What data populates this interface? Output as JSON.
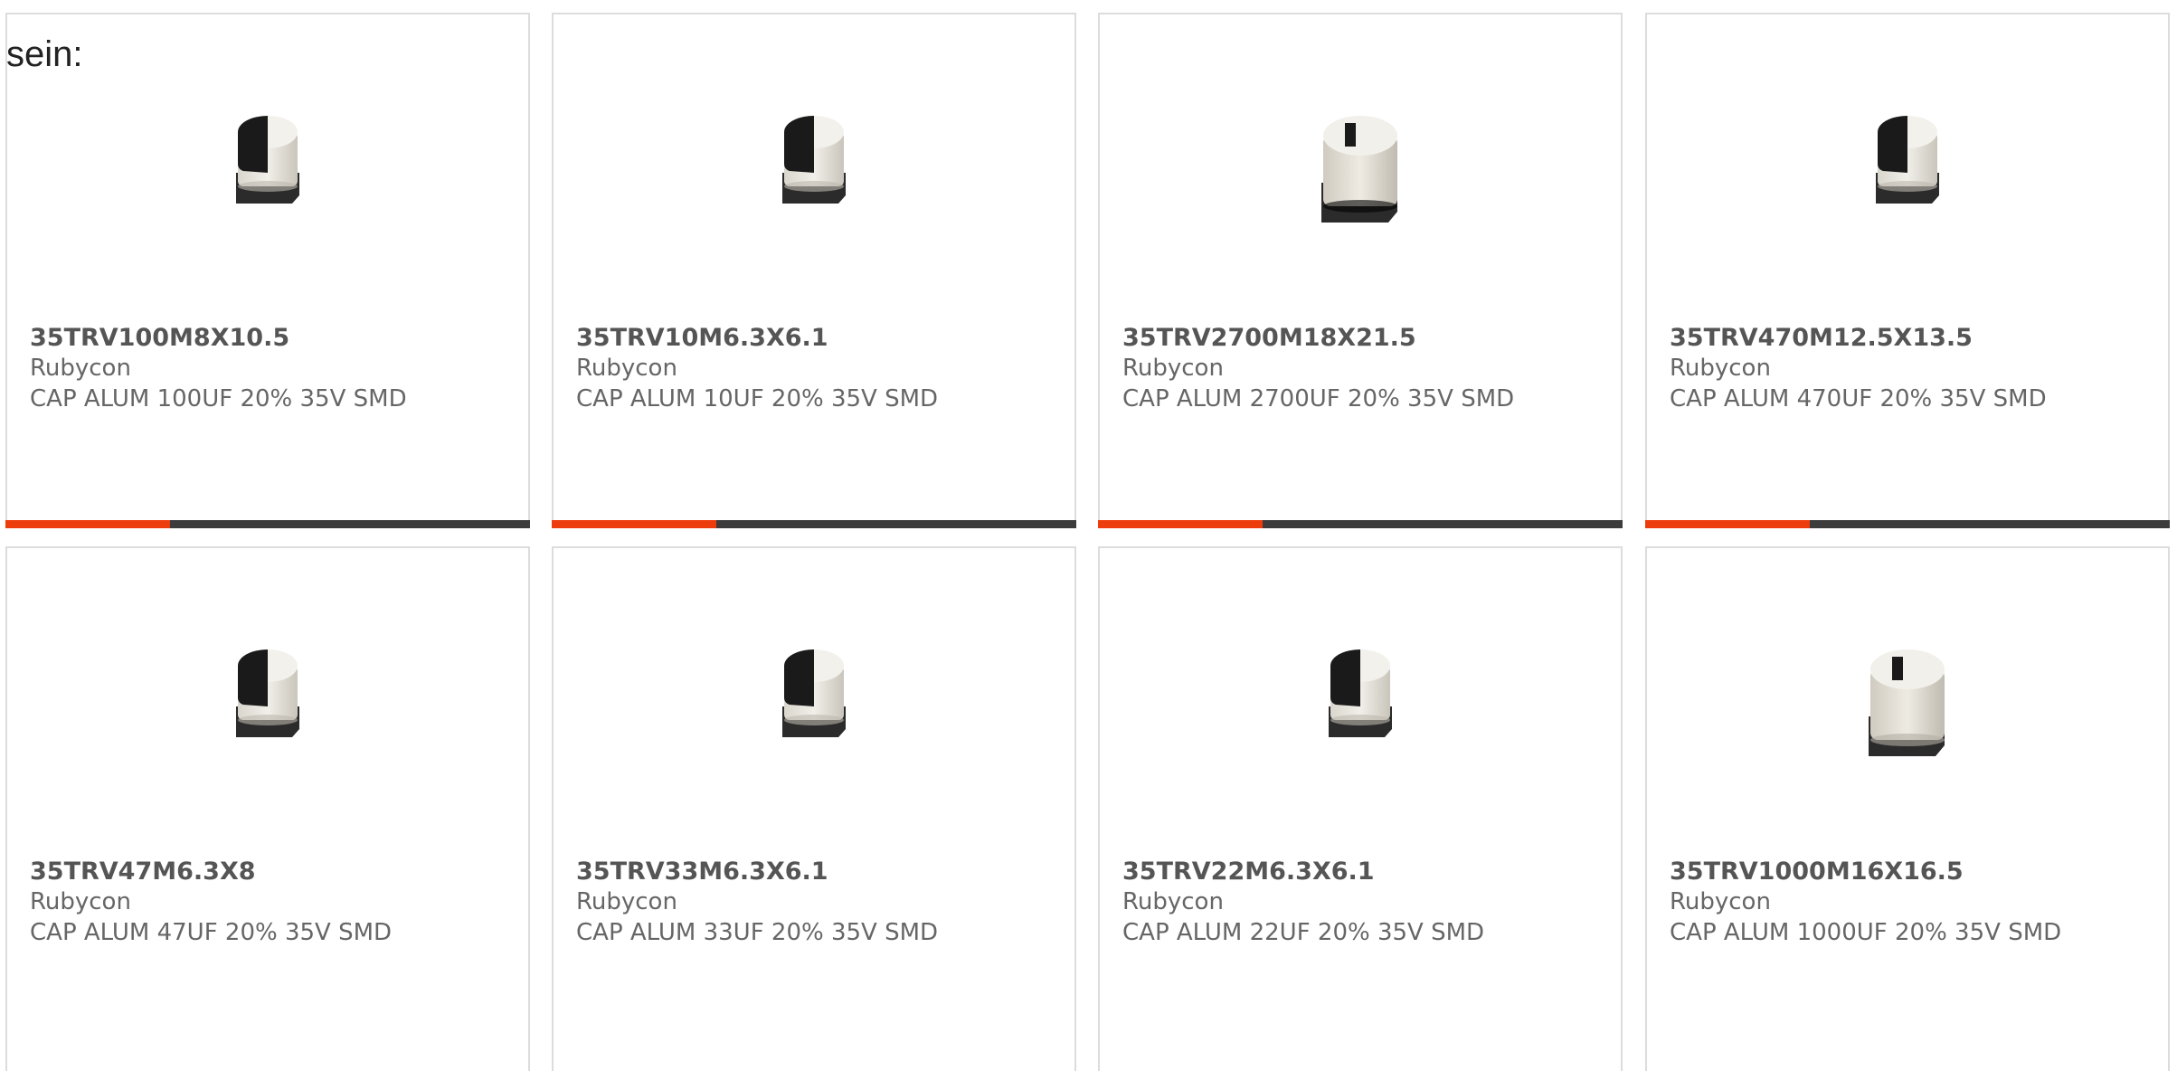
{
  "heading": "sein:",
  "colors": {
    "accent": "#ee3d0d",
    "bar": "#3c3c3c",
    "border": "#dcdcdc",
    "text": "#666666"
  },
  "products": [
    {
      "part_number": "35TRV100M8X10.5",
      "manufacturer": "Rubycon",
      "description": "CAP ALUM 100UF 20% 35V SMD",
      "image": "capacitor-small-icon"
    },
    {
      "part_number": "35TRV10M6.3X6.1",
      "manufacturer": "Rubycon",
      "description": "CAP ALUM 10UF 20% 35V SMD",
      "image": "capacitor-small-icon"
    },
    {
      "part_number": "35TRV2700M18X21.5",
      "manufacturer": "Rubycon",
      "description": "CAP ALUM 2700UF 20% 35V SMD",
      "image": "capacitor-large-icon"
    },
    {
      "part_number": "35TRV470M12.5X13.5",
      "manufacturer": "Rubycon",
      "description": "CAP ALUM 470UF 20% 35V SMD",
      "image": "capacitor-small-icon"
    },
    {
      "part_number": "35TRV47M6.3X8",
      "manufacturer": "Rubycon",
      "description": "CAP ALUM 47UF 20% 35V SMD",
      "image": "capacitor-small-icon"
    },
    {
      "part_number": "35TRV33M6.3X6.1",
      "manufacturer": "Rubycon",
      "description": "CAP ALUM 33UF 20% 35V SMD",
      "image": "capacitor-small-icon"
    },
    {
      "part_number": "35TRV22M6.3X6.1",
      "manufacturer": "Rubycon",
      "description": "CAP ALUM 22UF 20% 35V SMD",
      "image": "capacitor-small-icon"
    },
    {
      "part_number": "35TRV1000M16X16.5",
      "manufacturer": "Rubycon",
      "description": "CAP ALUM 1000UF 20% 35V SMD",
      "image": "capacitor-large-icon"
    }
  ]
}
